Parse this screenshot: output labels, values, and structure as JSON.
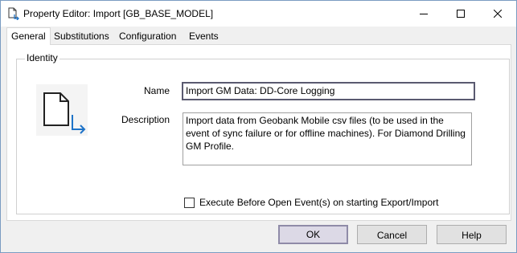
{
  "window": {
    "title": "Property Editor: Import [GB_BASE_MODEL]",
    "app_icon": "document-import-icon",
    "controls": [
      "minimize-icon",
      "maximize-icon",
      "close-icon"
    ]
  },
  "tabs": [
    {
      "label": "General",
      "active": true
    },
    {
      "label": "Substitutions",
      "active": false
    },
    {
      "label": "Configuration",
      "active": false
    },
    {
      "label": "Events",
      "active": false
    }
  ],
  "identity": {
    "group_label": "Identity",
    "icon": "document-import-icon",
    "name_label": "Name",
    "name_value": "Import GM Data: DD-Core Logging",
    "description_label": "Description",
    "description_value": "Import data from Geobank Mobile csv files (to be used in the event of sync failure or for offline machines). For Diamond Drilling GM Profile.",
    "execute_before_label": "Execute Before Open Event(s) on starting Export/Import",
    "execute_before_checked": false
  },
  "buttons": {
    "ok": "OK",
    "cancel": "Cancel",
    "help": "Help"
  }
}
